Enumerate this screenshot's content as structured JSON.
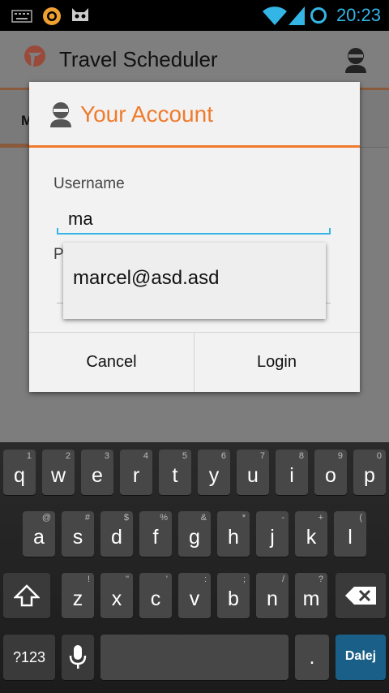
{
  "status_bar": {
    "time": "20:23"
  },
  "app": {
    "title": "Travel Scheduler",
    "tab_partial": "M"
  },
  "dialog": {
    "title": "Your Account",
    "username_label": "Username",
    "username_value": "ma",
    "password_label_partial": "P",
    "cancel_label": "Cancel",
    "login_label": "Login"
  },
  "autocomplete": {
    "suggestion": "marcel@asd.asd"
  },
  "keyboard": {
    "row1": [
      {
        "k": "q",
        "s": "1"
      },
      {
        "k": "w",
        "s": "2"
      },
      {
        "k": "e",
        "s": "3"
      },
      {
        "k": "r",
        "s": "4"
      },
      {
        "k": "t",
        "s": "5"
      },
      {
        "k": "y",
        "s": "6"
      },
      {
        "k": "u",
        "s": "7"
      },
      {
        "k": "i",
        "s": "8"
      },
      {
        "k": "o",
        "s": "9"
      },
      {
        "k": "p",
        "s": "0"
      }
    ],
    "row2": [
      {
        "k": "a",
        "s": "@"
      },
      {
        "k": "s",
        "s": "#"
      },
      {
        "k": "d",
        "s": "$"
      },
      {
        "k": "f",
        "s": "%"
      },
      {
        "k": "g",
        "s": "&"
      },
      {
        "k": "h",
        "s": "*"
      },
      {
        "k": "j",
        "s": "-"
      },
      {
        "k": "k",
        "s": "+"
      },
      {
        "k": "l",
        "s": "("
      }
    ],
    "row3": [
      {
        "k": "z",
        "s": "!"
      },
      {
        "k": "x",
        "s": "\""
      },
      {
        "k": "c",
        "s": "'"
      },
      {
        "k": "v",
        "s": ":"
      },
      {
        "k": "b",
        "s": ";"
      },
      {
        "k": "n",
        "s": "/"
      },
      {
        "k": "m",
        "s": "?"
      }
    ],
    "symbols_label": "?123",
    "period_label": ".",
    "enter_label": "Dalej"
  }
}
